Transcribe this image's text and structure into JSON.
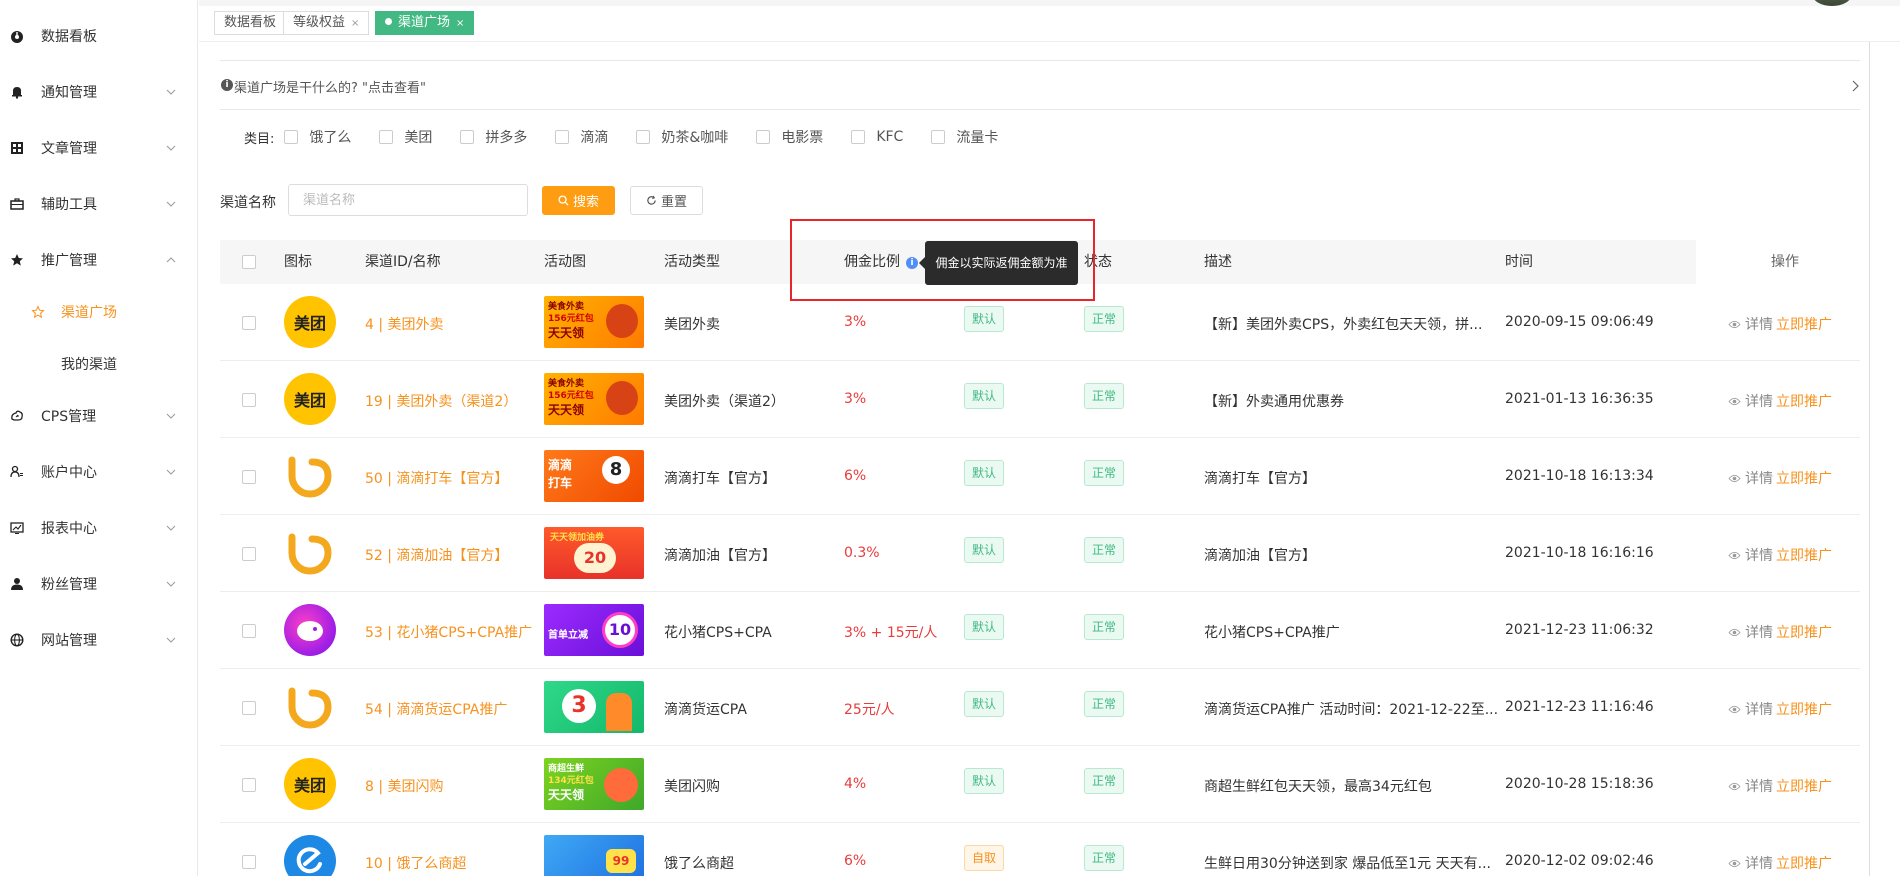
{
  "sidebar": {
    "items": [
      {
        "label": "数据看板",
        "icon": "dashboard-icon"
      },
      {
        "label": "通知管理",
        "icon": "bell-icon"
      },
      {
        "label": "文章管理",
        "icon": "grid-icon"
      },
      {
        "label": "辅助工具",
        "icon": "toolbox-icon"
      },
      {
        "label": "推广管理",
        "icon": "star-icon"
      },
      {
        "label": "CPS管理",
        "icon": "cps-icon"
      },
      {
        "label": "账户中心",
        "icon": "account-icon"
      },
      {
        "label": "报表中心",
        "icon": "report-icon"
      },
      {
        "label": "粉丝管理",
        "icon": "user-icon"
      },
      {
        "label": "网站管理",
        "icon": "globe-icon"
      }
    ],
    "subitems": [
      {
        "label": "渠道广场",
        "active": true
      },
      {
        "label": "我的渠道",
        "active": false
      }
    ]
  },
  "tabs": [
    {
      "label": "数据看板"
    },
    {
      "label": "等级权益",
      "close": "×"
    },
    {
      "label": "渠道广场",
      "close": "×"
    }
  ],
  "info": {
    "text": "渠道广场是干什么的? \"点击查看\""
  },
  "filter": {
    "category_label": "类目:",
    "categories": [
      "饿了么",
      "美团",
      "拼多多",
      "滴滴",
      "奶茶&咖啡",
      "电影票",
      "KFC",
      "流量卡"
    ],
    "search_label": "渠道名称",
    "search_placeholder": "渠道名称",
    "search_button": "搜索",
    "reset_button": "重置"
  },
  "table": {
    "headers": {
      "icon": "图标",
      "name": "渠道ID/名称",
      "image": "活动图",
      "type": "活动类型",
      "commission": "佣金比例",
      "status": "状态",
      "desc": "描述",
      "time": "时间",
      "ops": "操作"
    },
    "tooltip": "佣金以实际返佣金额为准",
    "detail_label": "详情",
    "promote_label": "立即推广",
    "rows": [
      {
        "logo": "美团",
        "name": "4 | 美团外卖",
        "type": "美团外卖",
        "commission": "3%",
        "tag": "默认",
        "status": "正常",
        "desc": "【新】美团外卖CPS，外卖红包天天领，拼...",
        "time": "2020-09-15 09:06:49"
      },
      {
        "logo": "美团",
        "name": "19 | 美团外卖（渠道2）",
        "type": "美团外卖（渠道2）",
        "commission": "3%",
        "tag": "默认",
        "status": "正常",
        "desc": "【新】外卖通用优惠券",
        "time": "2021-01-13 16:36:35"
      },
      {
        "logo": "",
        "name": "50 | 滴滴打车【官方】",
        "type": "滴滴打车【官方】",
        "commission": "6%",
        "tag": "默认",
        "status": "正常",
        "desc": "滴滴打车【官方】",
        "time": "2021-10-18 16:13:34"
      },
      {
        "logo": "",
        "name": "52 | 滴滴加油【官方】",
        "type": "滴滴加油【官方】",
        "commission": "0.3%",
        "tag": "默认",
        "status": "正常",
        "desc": "滴滴加油【官方】",
        "time": "2021-10-18 16:16:16"
      },
      {
        "logo": "",
        "name": "53 | 花小猪CPS+CPA推广",
        "type": "花小猪CPS+CPA",
        "commission": "3% + 15元/人",
        "tag": "默认",
        "status": "正常",
        "desc": "花小猪CPS+CPA推广",
        "time": "2021-12-23 11:06:32"
      },
      {
        "logo": "",
        "name": "54 | 滴滴货运CPA推广",
        "type": "滴滴货运CPA",
        "commission": "25元/人",
        "tag": "默认",
        "status": "正常",
        "desc": "滴滴货运CPA推广 活动时间：2021-12-22至...",
        "time": "2021-12-23 11:16:46"
      },
      {
        "logo": "美团",
        "name": "8 | 美团闪购",
        "type": "美团闪购",
        "commission": "4%",
        "tag": "默认",
        "status": "正常",
        "desc": "商超生鲜红包天天领，最高34元红包",
        "time": "2020-10-28 15:18:36"
      },
      {
        "logo": "",
        "name": "10 | 饿了么商超",
        "type": "饿了么商超",
        "commission": "6%",
        "tag": "自取",
        "status": "正常",
        "desc": "生鲜日用30分钟送到家 爆品低至1元 天天有...",
        "time": "2020-12-02 09:02:46"
      }
    ],
    "images": [
      {
        "line1": "美食外卖",
        "line2": "156元红包",
        "line3": "天天领"
      },
      {
        "line1": "美食外卖",
        "line2": "156元红包",
        "line3": "天天领"
      },
      {
        "line1": "滴滴",
        "line2": "打车",
        "line3": "8"
      },
      {
        "line1": "天天领加油券",
        "line2": "20",
        "line3": ""
      },
      {
        "line1": "首单立减",
        "line2": "10",
        "line3": ""
      },
      {
        "line1": "3",
        "line2": "",
        "line3": ""
      },
      {
        "line1": "商超生鲜",
        "line2": "134元红包",
        "line3": "天天领"
      },
      {
        "line1": "99",
        "line2": "",
        "line3": ""
      }
    ]
  },
  "colors": {
    "accent": "#f7921e",
    "success": "#42b983",
    "danger": "#e83b3b",
    "tooltip_bg": "#2b2b2b",
    "highlight": "#e8242c"
  }
}
